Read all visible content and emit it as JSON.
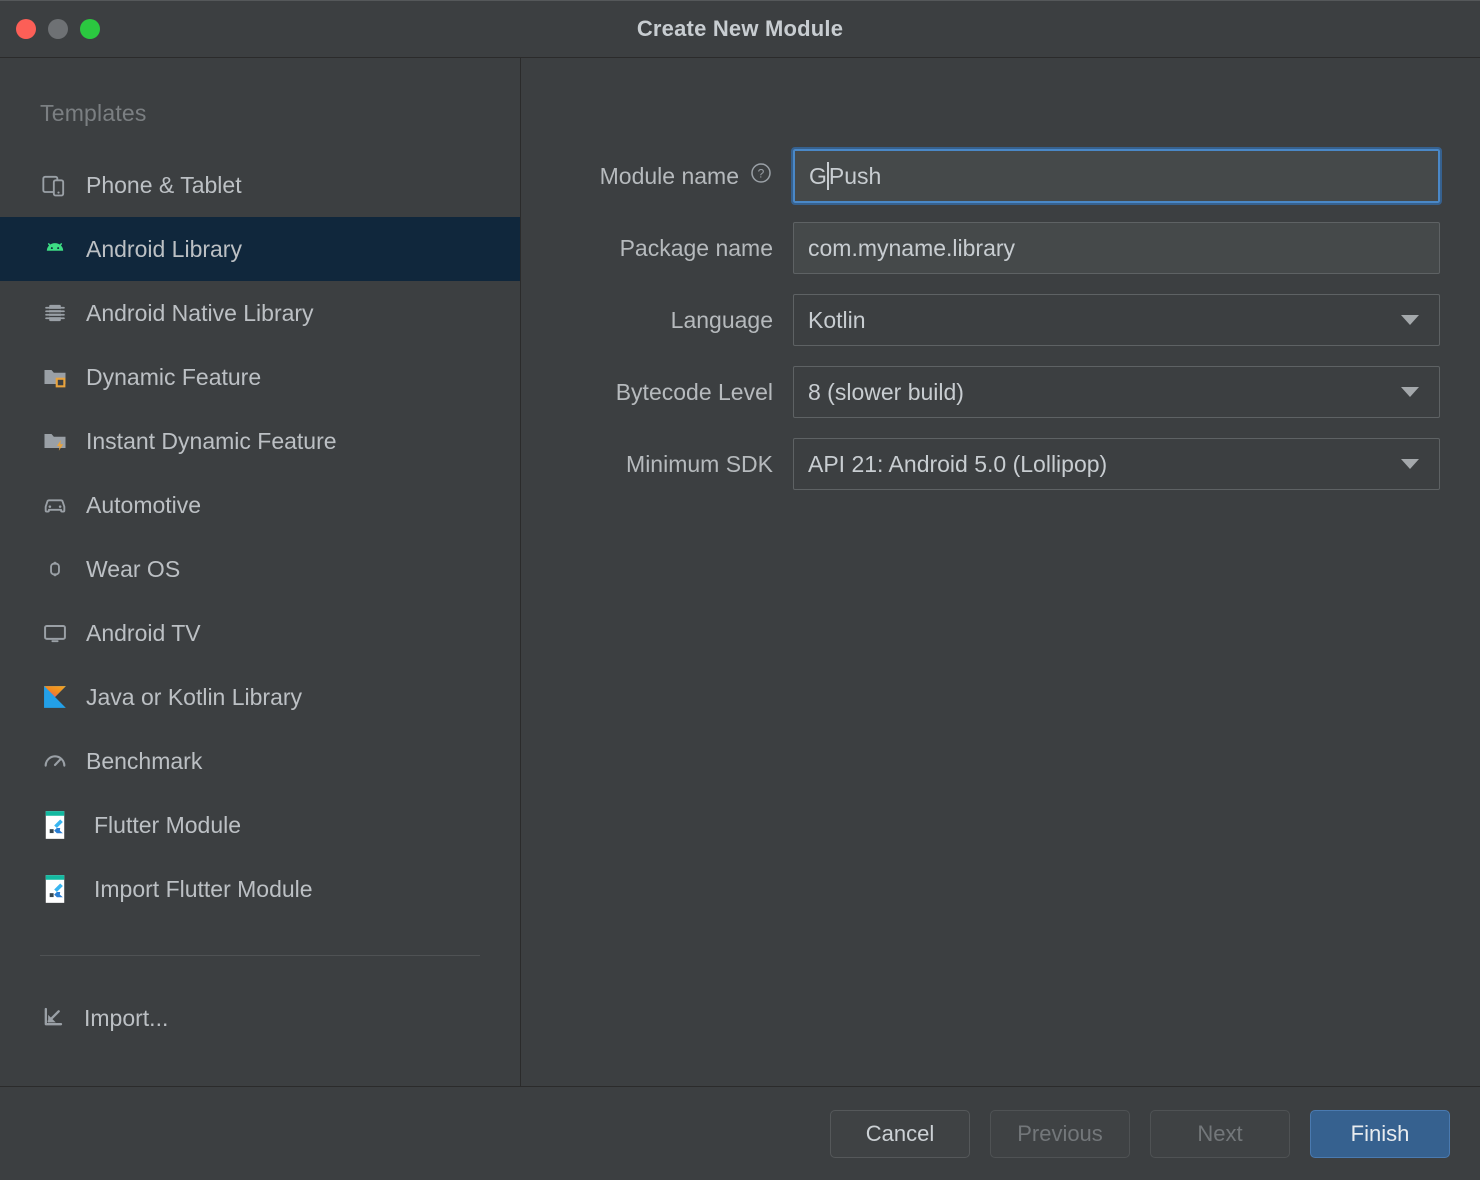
{
  "window": {
    "title": "Create New Module",
    "traffic_lights": [
      {
        "name": "close",
        "color": "#fc5f57"
      },
      {
        "name": "minimize",
        "color": "#6e7174"
      },
      {
        "name": "maximize",
        "color": "#2bc840"
      }
    ]
  },
  "sidebar": {
    "heading": "Templates",
    "items": [
      {
        "label": "Phone & Tablet",
        "icon": "phone-tablet-icon",
        "selected": false
      },
      {
        "label": "Android Library",
        "icon": "android-robot-icon",
        "selected": true
      },
      {
        "label": "Android Native Library",
        "icon": "chip-icon",
        "selected": false
      },
      {
        "label": "Dynamic Feature",
        "icon": "folder-module-icon",
        "selected": false
      },
      {
        "label": "Instant Dynamic Feature",
        "icon": "folder-lightning-icon",
        "selected": false
      },
      {
        "label": "Automotive",
        "icon": "car-icon",
        "selected": false
      },
      {
        "label": "Wear OS",
        "icon": "watch-icon",
        "selected": false
      },
      {
        "label": "Android TV",
        "icon": "tv-icon",
        "selected": false
      },
      {
        "label": "Java or Kotlin Library",
        "icon": "kotlin-logo-icon",
        "selected": false
      },
      {
        "label": "Benchmark",
        "icon": "speedometer-icon",
        "selected": false
      },
      {
        "label": "Flutter Module",
        "icon": "flutter-icon",
        "selected": false
      },
      {
        "label": "Import Flutter Module",
        "icon": "flutter-icon",
        "selected": false
      }
    ],
    "import": {
      "label": "Import...",
      "icon": "import-arrow-icon"
    }
  },
  "form": {
    "fields": [
      {
        "label": "Module name",
        "type": "text",
        "value": "GPush",
        "value_before_caret": "G",
        "value_after_caret": "Push",
        "focused": true,
        "help_icon": "question-circle-icon"
      },
      {
        "label": "Package name",
        "type": "text",
        "value": "com.myname.library",
        "focused": false
      },
      {
        "label": "Language",
        "type": "select",
        "value": "Kotlin",
        "focused": false
      },
      {
        "label": "Bytecode Level",
        "type": "select",
        "value": "8 (slower build)",
        "focused": false
      },
      {
        "label": "Minimum SDK",
        "type": "select",
        "value": "API 21: Android 5.0 (Lollipop)",
        "focused": false
      }
    ]
  },
  "footer": {
    "buttons": [
      {
        "label": "Cancel",
        "state": "normal"
      },
      {
        "label": "Previous",
        "state": "disabled"
      },
      {
        "label": "Next",
        "state": "disabled"
      },
      {
        "label": "Finish",
        "state": "primary"
      }
    ]
  },
  "colors": {
    "dialog_bg": "#3c3f41",
    "selection_bg": "#10273c",
    "accent_blue": "#4a88c7",
    "primary_button": "#36618f",
    "android_green": "#3ddc84",
    "flutter_teal": "#13b9a0",
    "text": "#bcc0c4",
    "muted_text": "#7b7f82"
  }
}
